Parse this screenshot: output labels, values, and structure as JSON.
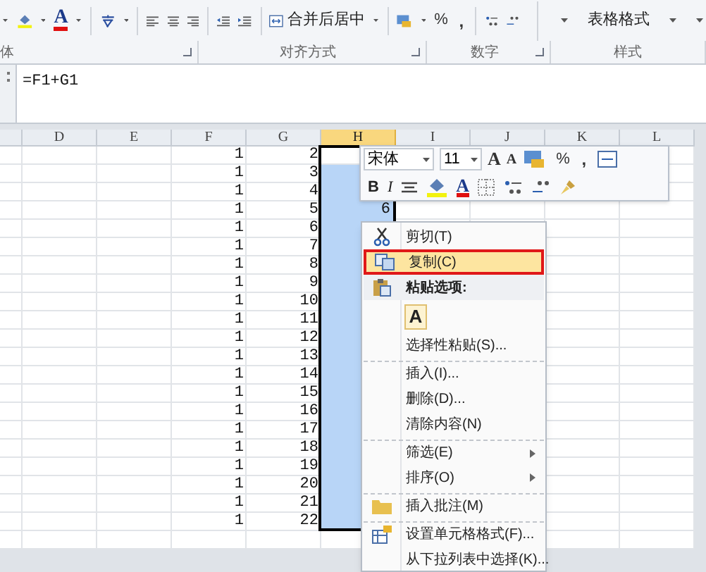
{
  "ribbon": {
    "font_color_glyph": "A",
    "merge_button": "合并后居中",
    "percent": "%",
    "comma": ",",
    "styles_button": "表格格式",
    "groups": [
      {
        "label": "体",
        "launcher": true
      },
      {
        "label": "对齐方式",
        "launcher": true
      },
      {
        "label": "数字",
        "launcher": true
      },
      {
        "label": "样式",
        "launcher": false
      }
    ]
  },
  "formula_bar": {
    "formula": "=F1+G1"
  },
  "sheet": {
    "columns": [
      {
        "selected": false
      },
      {
        "label": "D",
        "selected": false
      },
      {
        "label": "E",
        "selected": false
      },
      {
        "label": "F",
        "selected": false
      },
      {
        "label": "G",
        "selected": false
      },
      {
        "label": "H",
        "selected": true
      },
      {
        "label": "I",
        "selected": false
      },
      {
        "label": "J",
        "selected": false
      },
      {
        "label": "K",
        "selected": false
      },
      {
        "label": "L",
        "selected": false
      }
    ],
    "rows": [
      {
        "f": "1",
        "g": "2",
        "selected": false
      },
      {
        "f": "1",
        "g": "3",
        "selected": true
      },
      {
        "f": "1",
        "g": "4",
        "selected": true
      },
      {
        "f": "1",
        "g": "5",
        "h": "6",
        "selected": true
      },
      {
        "f": "1",
        "g": "6",
        "selected": true
      },
      {
        "f": "1",
        "g": "7",
        "selected": true
      },
      {
        "f": "1",
        "g": "8",
        "selected": true
      },
      {
        "f": "1",
        "g": "9",
        "selected": true
      },
      {
        "f": "1",
        "g": "10",
        "selected": true
      },
      {
        "f": "1",
        "g": "11",
        "selected": true
      },
      {
        "f": "1",
        "g": "12",
        "selected": true
      },
      {
        "f": "1",
        "g": "13",
        "selected": true
      },
      {
        "f": "1",
        "g": "14",
        "selected": true
      },
      {
        "f": "1",
        "g": "15",
        "selected": true
      },
      {
        "f": "1",
        "g": "16",
        "selected": true
      },
      {
        "f": "1",
        "g": "17",
        "selected": true
      },
      {
        "f": "1",
        "g": "18",
        "selected": true
      },
      {
        "f": "1",
        "g": "19",
        "selected": true
      },
      {
        "f": "1",
        "g": "20",
        "selected": true
      },
      {
        "f": "1",
        "g": "21",
        "selected": true
      },
      {
        "f": "1",
        "g": "22",
        "selected": true
      },
      {
        "selected": false
      }
    ]
  },
  "mini_toolbar": {
    "font": "宋体",
    "size": "11",
    "grow_glyph": "A",
    "shrink_glyph": "A",
    "percent": "%",
    "comma": ",",
    "bold": "B",
    "italic": "I",
    "font_color_glyph": "A"
  },
  "context_menu": {
    "items": [
      {
        "kind": "cut",
        "label": "剪切(T)",
        "selected": false,
        "separator_above": false
      },
      {
        "kind": "copy",
        "label": "复制(C)",
        "selected": true,
        "separator_above": false
      },
      {
        "kind": "header",
        "label": "粘贴选项:",
        "selected": false,
        "separator_above": false
      },
      {
        "kind": "paste",
        "label": "A",
        "selected": false,
        "separator_above": false
      },
      {
        "kind": "item",
        "label": "选择性粘贴(S)...",
        "selected": false,
        "separator_above": false
      },
      {
        "kind": "item",
        "label": "插入(I)...",
        "selected": false,
        "separator_above": true
      },
      {
        "kind": "item",
        "label": "删除(D)...",
        "selected": false,
        "separator_above": false
      },
      {
        "kind": "item",
        "label": "清除内容(N)",
        "selected": false,
        "separator_above": false
      },
      {
        "kind": "submenu",
        "label": "筛选(E)",
        "selected": false,
        "separator_above": true
      },
      {
        "kind": "submenu",
        "label": "排序(O)",
        "selected": false,
        "separator_above": false
      },
      {
        "kind": "comment",
        "label": "插入批注(M)",
        "selected": false,
        "separator_above": true
      },
      {
        "kind": "format",
        "label": "设置单元格格式(F)...",
        "selected": false,
        "separator_above": true
      },
      {
        "kind": "item",
        "label": "从下拉列表中选择(K)...",
        "selected": false,
        "separator_above": false
      }
    ]
  }
}
